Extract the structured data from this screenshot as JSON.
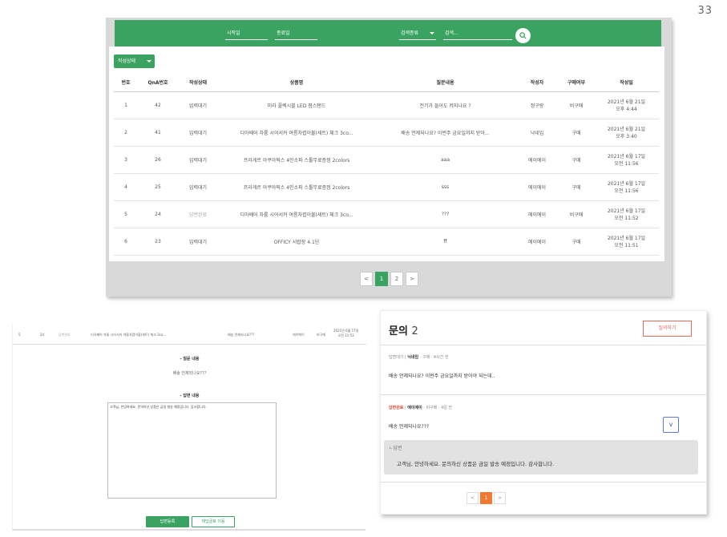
{
  "page_number": "33",
  "admin": {
    "filters": {
      "start_date": "시작일",
      "end_date": "종료일",
      "search_type": "검색종류",
      "search_placeholder": "검색..."
    },
    "status_dropdown": "작성상태",
    "columns": [
      "번호",
      "QnA번호",
      "작성상태",
      "상품명",
      "질문내용",
      "작성자",
      "구매여부",
      "작성일"
    ],
    "rows": [
      {
        "no": "1",
        "qna": "42",
        "status": "입력대기",
        "product": "미라 플렉시블 LED 점스탠드",
        "question": "전기가 들어도 켜지나요 ?",
        "author": "정구랑",
        "purchase": "비구매",
        "date1": "2021년 6월 21일",
        "date2": "오후 4:44"
      },
      {
        "no": "2",
        "qna": "41",
        "status": "입력대기",
        "product": "디아쎄어 차륭 시어서커 여름차렵이불(세트) 체크 3co...",
        "question": "배송 언제되나요? 이번주 금요일까지 받아...",
        "author": "낙네임",
        "purchase": "구매",
        "date1": "2021년 6월 21일",
        "date2": "오후 3:40"
      },
      {
        "no": "3",
        "qna": "26",
        "status": "입력대기",
        "product": "프라게르 아쿠아픽스 4인소파 스툴무료증정 2colors",
        "question": "aaa",
        "author": "에이에이",
        "purchase": "구매",
        "date1": "2021년 6월 17일",
        "date2": "오전 11:56"
      },
      {
        "no": "4",
        "qna": "25",
        "status": "입력대기",
        "product": "프라게르 아쿠아픽스 4인소파 스툴무료증정 2colors",
        "question": "sss",
        "author": "에이에이",
        "purchase": "구매",
        "date1": "2021년 6월 17일",
        "date2": "오전 11:56"
      },
      {
        "no": "5",
        "qna": "24",
        "status": "답변완료",
        "product": "디아쎄어 차륭 시어서커 여름차렵이불(세트) 체크 3co...",
        "question": "???",
        "author": "에이에이",
        "purchase": "비구매",
        "date1": "2021년 6월 17일",
        "date2": "오전 11:52"
      },
      {
        "no": "6",
        "qna": "23",
        "status": "입력대기",
        "product": "OFFICY 서랍장 4.1단",
        "question": "ff",
        "author": "에이에이",
        "purchase": "구매",
        "date1": "2021년 6월 17일",
        "date2": "오전 11:51"
      }
    ],
    "pager": [
      "<",
      "1",
      "2",
      ">"
    ]
  },
  "detail": {
    "row": {
      "no": "5",
      "qna": "24",
      "status": "답변완료",
      "product": "디아쎄어 차륭 시어서커 여름차렵이불(세트) 체크 3co...",
      "question": "배송 언제되나요???",
      "author": "에이에이",
      "purchase": "비구매",
      "date1": "2021년 6월 17일",
      "date2": "오전 11:52"
    },
    "question_title": "- 질문 내용",
    "question_text": "배송 언제되나요???",
    "answer_title": "- 답변 내용",
    "answer_text": "고객님, 안녕하세요. 문의하신 상품은 금일 발송 예정입니다. 감사합니다.",
    "submit_btn": "답변등록",
    "reset_btn": "재답글로 이동"
  },
  "inquiry": {
    "title": "문의",
    "count": "2",
    "write_btn": "질의하기",
    "item1": {
      "status": "답변대기",
      "author": "닉네임",
      "purchase": "구매",
      "time": "4시간 전",
      "question": "배송 언제되나요? 이번주 금요일까지 받아야 되는데.."
    },
    "item2": {
      "status": "답변완료",
      "author": "에이에이",
      "purchase": "비구매",
      "time": "4일 전",
      "question": "배송 언제되나요???"
    },
    "toggle": "v",
    "answer_label": "ㄴ답변",
    "answer_text": "고객님, 안녕하세요. 문의하신 상품은 금일 발송 예정입니다. 감사합니다.",
    "pager": [
      "<",
      "1",
      ">"
    ]
  },
  "colors": {
    "green": "#3aa362",
    "orange": "#f07a34",
    "red": "#e04c3a"
  }
}
